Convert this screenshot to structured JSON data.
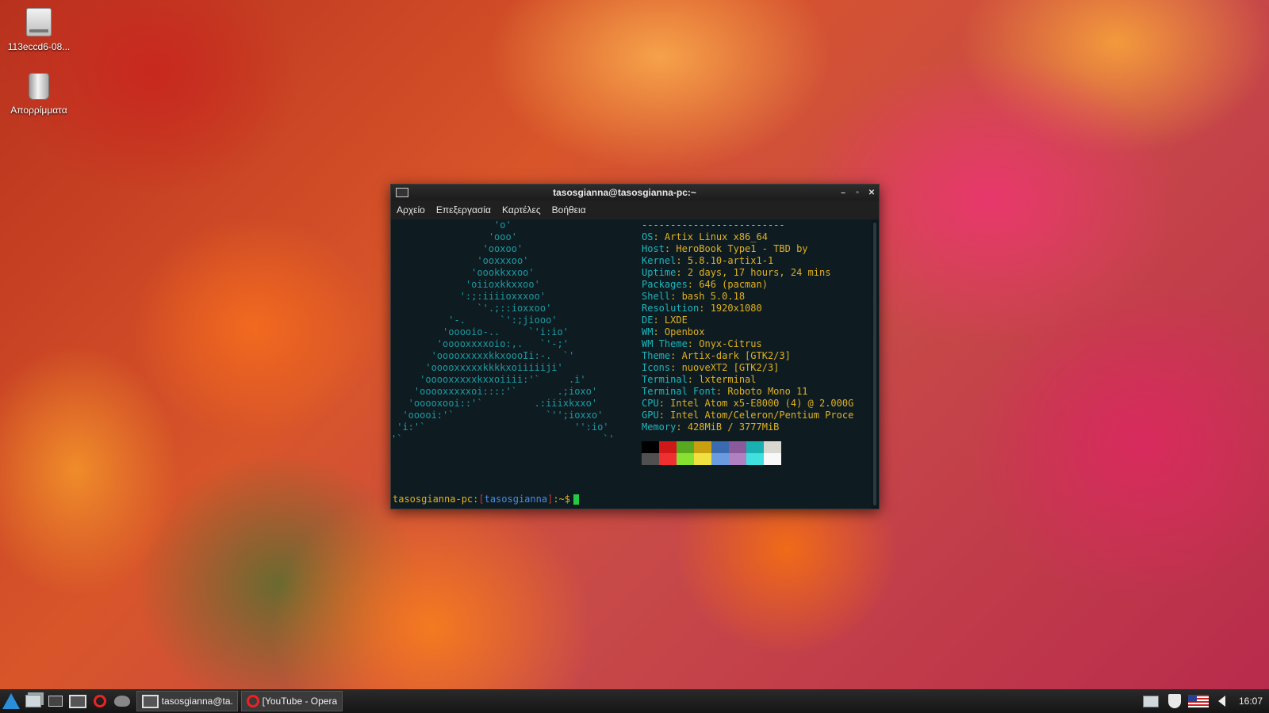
{
  "desktop": {
    "icons": [
      {
        "label": "113eccd6-08..."
      },
      {
        "label": "Απορρίμματα"
      }
    ]
  },
  "terminal": {
    "title": "tasosgianna@tasosgianna-pc:~",
    "controls": {
      "minimize": "–",
      "maximize": "▫",
      "close": "✕"
    },
    "menu": [
      "Αρχείο",
      "Επεξεργασία",
      "Καρτέλες",
      "Βοήθεια"
    ],
    "logo_lines": [
      "                  'o'",
      "                 'ooo'",
      "                'ooxoo'",
      "               'ooxxxoo'",
      "              'oookkxxoo'",
      "             'oiioxkkxxoo'",
      "            ':;:iiiioxxxoo'",
      "               `'.;::ioxxoo'",
      "          '-.      `':;jiooo'",
      "         'ooooio-..     `'i:io'",
      "        'ooooxxxxoio:,.   `'-;'",
      "       'ooooxxxxxkkxoooIi:-.  `'",
      "      'ooooxxxxxkkkkxoiiiiiji'",
      "     'ooooxxxxxkxxoiiii:'`     .i'",
      "    'ooooxxxxxoi::::'`       .;ioxo'",
      "   'ooooxooi::'`         .:iiixkxxo'",
      "  'ooooi:'`                `'';ioxxo'",
      " 'i:'`                          '':io'",
      "'`                                   `'"
    ],
    "separator": "-------------------------",
    "info": [
      {
        "key": "OS",
        "value": "Artix Linux x86_64"
      },
      {
        "key": "Host",
        "value": "HeroBook Type1 - TBD by"
      },
      {
        "key": "Kernel",
        "value": "5.8.10-artix1-1"
      },
      {
        "key": "Uptime",
        "value": "2 days, 17 hours, 24 mins"
      },
      {
        "key": "Packages",
        "value": "646 (pacman)"
      },
      {
        "key": "Shell",
        "value": "bash 5.0.18"
      },
      {
        "key": "Resolution",
        "value": "1920x1080"
      },
      {
        "key": "DE",
        "value": "LXDE"
      },
      {
        "key": "WM",
        "value": "Openbox"
      },
      {
        "key": "WM Theme",
        "value": "Onyx-Citrus"
      },
      {
        "key": "Theme",
        "value": "Artix-dark [GTK2/3]"
      },
      {
        "key": "Icons",
        "value": "nuoveXT2 [GTK2/3]"
      },
      {
        "key": "Terminal",
        "value": "lxterminal"
      },
      {
        "key": "Terminal Font",
        "value": "Roboto Mono 11"
      },
      {
        "key": "CPU",
        "value": "Intel Atom x5-E8000 (4) @ 2.000G"
      },
      {
        "key": "GPU",
        "value": "Intel Atom/Celeron/Pentium Proce"
      },
      {
        "key": "Memory",
        "value": "428MiB / 3777MiB"
      }
    ],
    "palette_top": [
      "#000000",
      "#d01818",
      "#58a820",
      "#c8a010",
      "#3a6ab0",
      "#8a5a9a",
      "#18b0b0",
      "#d8d8d0"
    ],
    "palette_bottom": [
      "#505050",
      "#f03030",
      "#88e030",
      "#f0e040",
      "#6a9ae0",
      "#b080c0",
      "#40e0e0",
      "#f8f8f8"
    ],
    "prompt": {
      "host": "tasosgianna-pc:",
      "open": "[",
      "user": "tasosgianna",
      "close": "]",
      "tail": ":~$"
    }
  },
  "taskbar": {
    "tasks": [
      {
        "label": "tasosgianna@ta..."
      },
      {
        "label": "[YouTube - Opera]"
      }
    ],
    "clock": "16:07"
  }
}
